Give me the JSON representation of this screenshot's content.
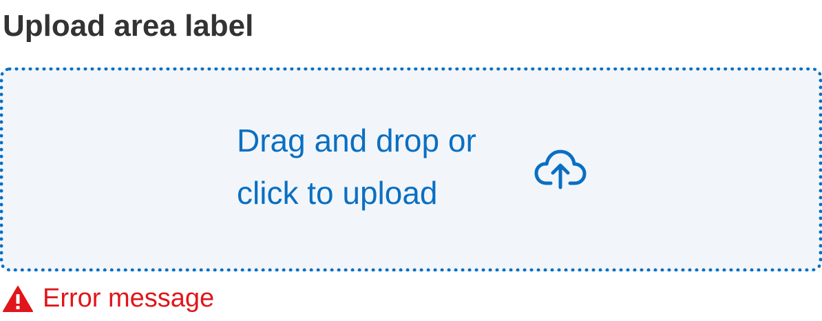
{
  "upload": {
    "label": "Upload area label",
    "line1": "Drag and drop or",
    "line2": "click to upload",
    "icon": "cloud-upload-icon",
    "accent_color": "#0a6fc2",
    "background_color": "#f2f6fa"
  },
  "error": {
    "message": "Error message",
    "icon": "warning-triangle-icon",
    "color": "#e0161a"
  }
}
